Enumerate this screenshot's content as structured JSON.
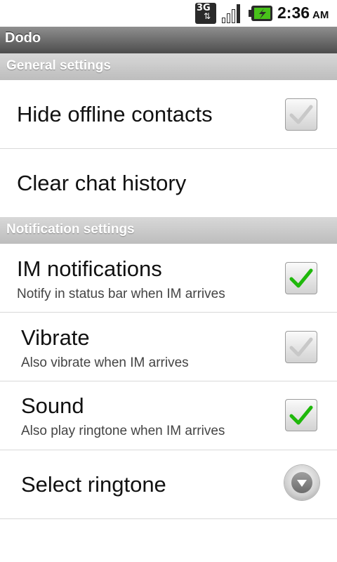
{
  "status_bar": {
    "network": "3G",
    "time": "2:36",
    "ampm": "AM"
  },
  "app": {
    "title": "Dodo"
  },
  "sections": {
    "general": {
      "header": "General settings",
      "hide_offline": {
        "title": "Hide offline contacts",
        "checked": false
      },
      "clear_history": {
        "title": "Clear chat history"
      }
    },
    "notification": {
      "header": "Notification settings",
      "im_notifications": {
        "title": "IM notifications",
        "summary": "Notify in status bar when IM arrives",
        "checked": true
      },
      "vibrate": {
        "title": "Vibrate",
        "summary": "Also vibrate when IM arrives",
        "checked": false
      },
      "sound": {
        "title": "Sound",
        "summary": "Also play ringtone when IM arrives",
        "checked": true
      },
      "ringtone": {
        "title": "Select ringtone"
      }
    }
  },
  "icons": {
    "check_checked_color": "#1fb80b",
    "check_unchecked_color": "#c8c8c8"
  }
}
